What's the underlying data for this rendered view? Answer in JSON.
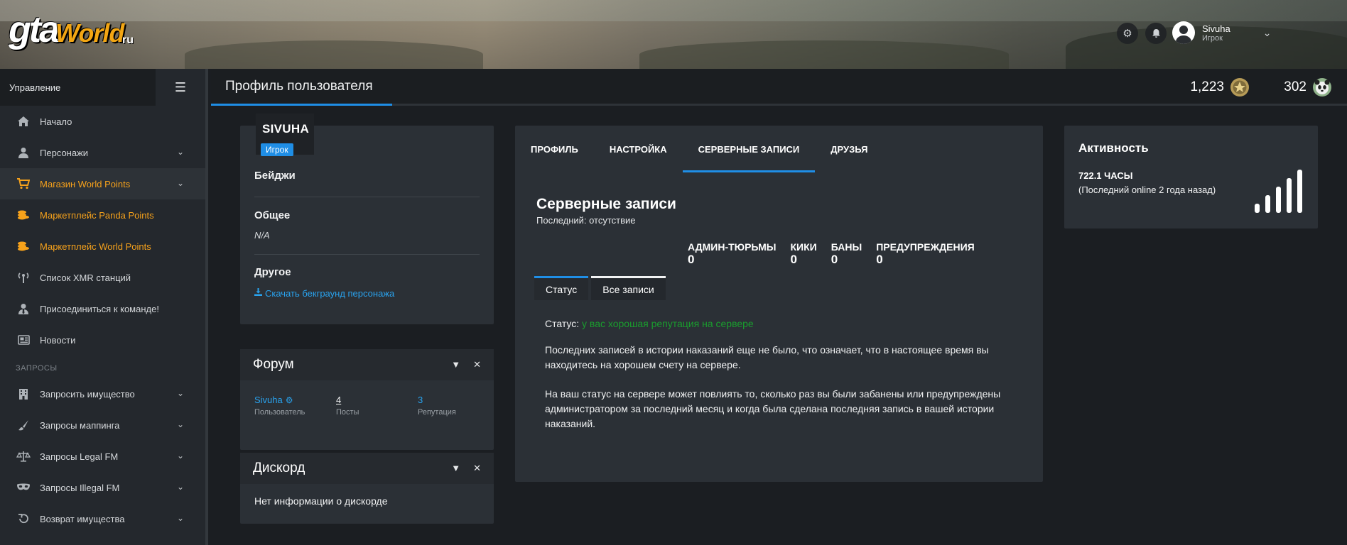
{
  "logo": {
    "gta": "gta",
    "world": "World",
    "ru": "ru"
  },
  "header": {
    "user_name": "Sivuha",
    "user_role": "Игрок"
  },
  "sidebar": {
    "title": "Управление",
    "items": [
      {
        "label": "Начало",
        "icon": "home-icon"
      },
      {
        "label": "Персонажи",
        "icon": "person-icon",
        "expandable": true
      },
      {
        "label": "Магазин World Points",
        "icon": "cart-icon",
        "expandable": true,
        "highlight": true
      },
      {
        "label": "Маркетплейс Panda Points",
        "icon": "coins-icon",
        "highlight": true
      },
      {
        "label": "Маркетплейс World Points",
        "icon": "coins-icon",
        "highlight": true
      },
      {
        "label": "Список XMR станций",
        "icon": "antenna-icon"
      },
      {
        "label": "Присоединиться к команде!",
        "icon": "user-tie-icon"
      },
      {
        "label": "Новости",
        "icon": "newspaper-icon"
      }
    ],
    "section_label": "ЗАПРОСЫ",
    "requests": [
      {
        "label": "Запросить имущество",
        "icon": "building-icon"
      },
      {
        "label": "Запросы маппинга",
        "icon": "brush-icon"
      },
      {
        "label": "Запросы Legal FM",
        "icon": "scale-icon"
      },
      {
        "label": "Запросы Illegal FM",
        "icon": "mask-icon"
      },
      {
        "label": "Возврат имущества",
        "icon": "undo-icon"
      }
    ]
  },
  "topbar": {
    "title": "Профиль пользователя",
    "world_points": "1,223",
    "panda_points": "302"
  },
  "profile": {
    "name": "SIVUHA",
    "role_badge": "Игрок",
    "badges_label": "Бейджи",
    "general_label": "Общее",
    "general_value": "N/A",
    "other_label": "Другое",
    "download_link": "Скачать бекграунд персонажа"
  },
  "forum": {
    "title": "Форум",
    "username": "Sivuha",
    "username_caption": "Пользователь",
    "posts": "4",
    "posts_caption": "Посты",
    "reputation": "3",
    "reputation_caption": "Репутация"
  },
  "discord": {
    "title": "Дискорд",
    "text": "Нет информации о дискорде"
  },
  "main": {
    "tabs": [
      "ПРОФИЛЬ",
      "НАСТРОЙКА",
      "СЕРВЕРНЫЕ ЗАПИСИ",
      "ДРУЗЬЯ"
    ],
    "active_tab": 2,
    "heading": "Серверные записи",
    "last": "Последний: отсутствие",
    "stats": [
      {
        "label": "АДМИН-ТЮРЬМЫ",
        "value": "0"
      },
      {
        "label": "КИКИ",
        "value": "0"
      },
      {
        "label": "БАНЫ",
        "value": "0"
      },
      {
        "label": "ПРЕДУПРЕЖДЕНИЯ",
        "value": "0"
      }
    ],
    "subtabs": [
      "Статус",
      "Все записи"
    ],
    "status_label": "Статус:",
    "status_value": "у вас хорошая репутация на сервере",
    "para1": "Последних записей в истории наказаний еще не было, что означает, что в настоящее время вы находитесь на хорошем счету на сервере.",
    "para2": "На ваш статус на сервере может повлиять то, сколько раз вы были забанены или предупреждены администратором за последний месяц и когда была сделана последняя запись в вашей истории наказаний."
  },
  "activity": {
    "title": "Активность",
    "hours": "722.1 ЧАСЫ",
    "last_online": "(Последний online 2 года назад)",
    "level": 5
  },
  "colors": {
    "accent": "#1f8ee6",
    "orange": "#f7a21b",
    "status_green": "#1a9d2e",
    "link": "#29a3ef"
  }
}
